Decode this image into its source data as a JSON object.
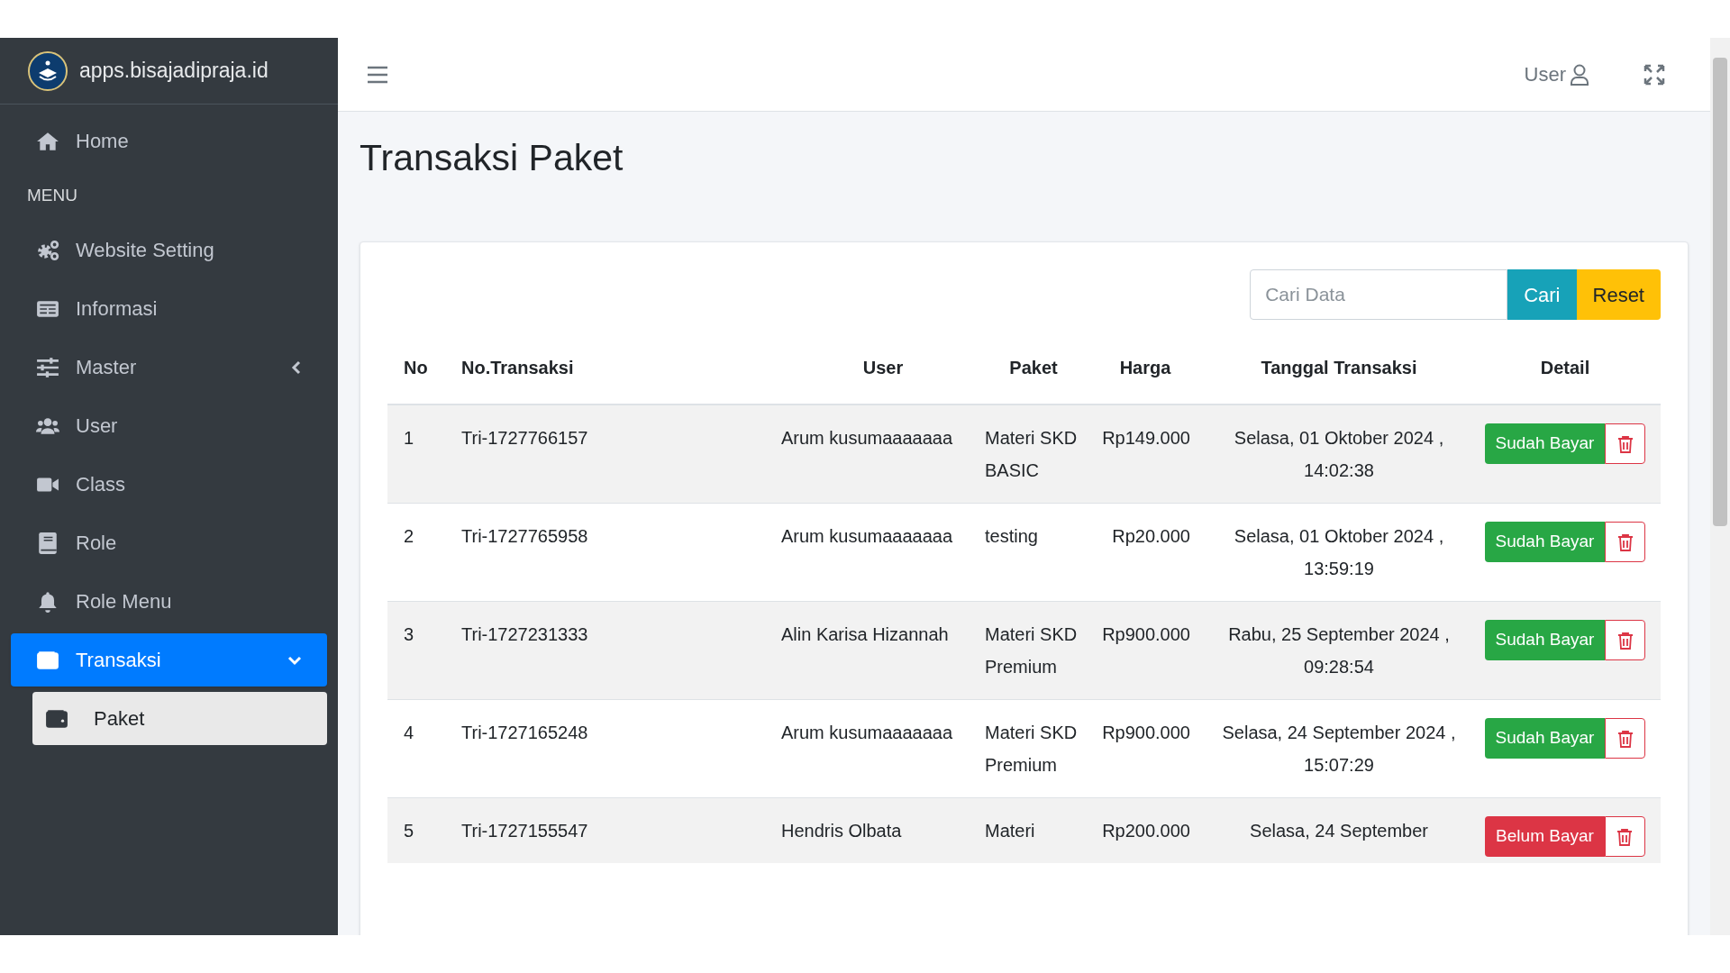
{
  "brand": {
    "title": "apps.bisajadipraja.id"
  },
  "sidebar": {
    "items": [
      {
        "kind": "link",
        "label": "Home",
        "selected": false
      },
      {
        "kind": "header",
        "label": "MENU"
      },
      {
        "kind": "link",
        "label": "Website Setting",
        "selected": false
      },
      {
        "kind": "link",
        "label": "Informasi",
        "selected": false
      },
      {
        "kind": "group",
        "label": "Master",
        "selected": false,
        "expanded": false
      },
      {
        "kind": "link",
        "label": "User",
        "selected": false
      },
      {
        "kind": "link",
        "label": "Class",
        "selected": false
      },
      {
        "kind": "link",
        "label": "Role",
        "selected": false
      },
      {
        "kind": "link",
        "label": "Role Menu",
        "selected": false
      },
      {
        "kind": "group",
        "label": "Transaksi",
        "selected": true,
        "expanded": true,
        "children": [
          {
            "label": "Paket",
            "selected": true
          }
        ]
      }
    ]
  },
  "topbar": {
    "user_label": "User"
  },
  "page": {
    "title": "Transaksi Paket"
  },
  "search": {
    "placeholder": "Cari Data",
    "search_button": "Cari",
    "reset_button": "Reset"
  },
  "table": {
    "columns": [
      "No",
      "No.Transaksi",
      "User",
      "Paket",
      "Harga",
      "Tanggal Transaksi",
      "Detail"
    ],
    "rows": [
      {
        "no": "1",
        "transaction": "Tri-1727766157",
        "user": "Arum kusumaaaaaaa",
        "package": "Materi SKD BASIC",
        "price": "Rp149.000",
        "date": "Selasa, 01 Oktober 2024 , 14:02:38",
        "paid": true,
        "status_label": "Sudah Bayar"
      },
      {
        "no": "2",
        "transaction": "Tri-1727765958",
        "user": "Arum kusumaaaaaaa",
        "package": "testing",
        "price": "Rp20.000",
        "date": "Selasa, 01 Oktober 2024 , 13:59:19",
        "paid": true,
        "status_label": "Sudah Bayar"
      },
      {
        "no": "3",
        "transaction": "Tri-1727231333",
        "user": "Alin Karisa Hizannah",
        "package": "Materi SKD Premium",
        "price": "Rp900.000",
        "date": "Rabu, 25 September 2024 , 09:28:54",
        "paid": true,
        "status_label": "Sudah Bayar"
      },
      {
        "no": "4",
        "transaction": "Tri-1727165248",
        "user": "Arum kusumaaaaaaa",
        "package": "Materi SKD Premium",
        "price": "Rp900.000",
        "date": "Selasa, 24 September 2024 , 15:07:29",
        "paid": true,
        "status_label": "Sudah Bayar"
      },
      {
        "no": "5",
        "transaction": "Tri-1727155547",
        "user": "Hendris Olbata",
        "package": "Materi",
        "price": "Rp200.000",
        "date": "Selasa, 24 September",
        "paid": false,
        "status_label": "Belum Bayar"
      }
    ]
  }
}
